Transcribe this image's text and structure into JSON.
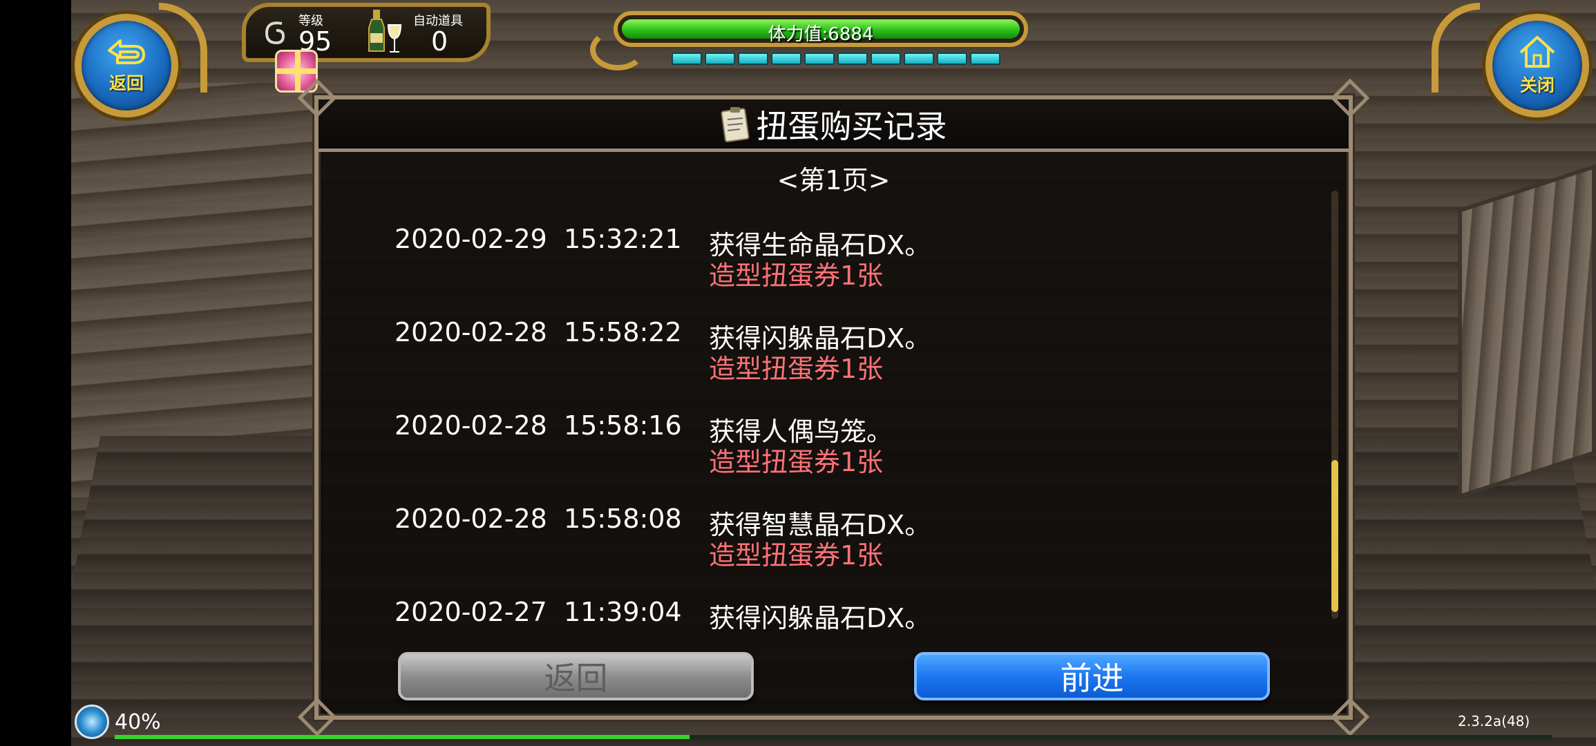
{
  "top_left": {
    "back_label": "返回",
    "level_label": "等级",
    "level_value": "95",
    "auto_item_label": "自动道具",
    "auto_item_value": "0"
  },
  "stamina": {
    "text": "体力值:6884",
    "fill_fraction": 1.0,
    "pip_count": 10
  },
  "top_right": {
    "close_label": "关闭"
  },
  "dialog": {
    "title": "扭蛋购买记录",
    "page_indicator": "<第1页>",
    "records": [
      {
        "time": "2020-02-29  15:32:21",
        "item": "获得生命晶石DX。",
        "cost": "造型扭蛋券1张"
      },
      {
        "time": "2020-02-28  15:58:22",
        "item": "获得闪躲晶石DX。",
        "cost": "造型扭蛋券1张"
      },
      {
        "time": "2020-02-28  15:58:16",
        "item": "获得人偶鸟笼。",
        "cost": "造型扭蛋券1张"
      },
      {
        "time": "2020-02-28  15:58:08",
        "item": "获得智慧晶石DX。",
        "cost": "造型扭蛋券1张"
      },
      {
        "time": "2020-02-27  11:39:04",
        "item": "获得闪躲晶石DX。",
        "cost": ""
      }
    ],
    "back_button": "返回",
    "forward_button": "前进"
  },
  "footer": {
    "load_percent_text": "40%",
    "load_fraction": 0.4,
    "version": "2.3.2a(48)"
  },
  "colors": {
    "accent_gold": "#c79a3a",
    "stamina_green": "#2bc21a",
    "cost_red": "#ff7277",
    "forward_blue": "#1d78f2"
  }
}
